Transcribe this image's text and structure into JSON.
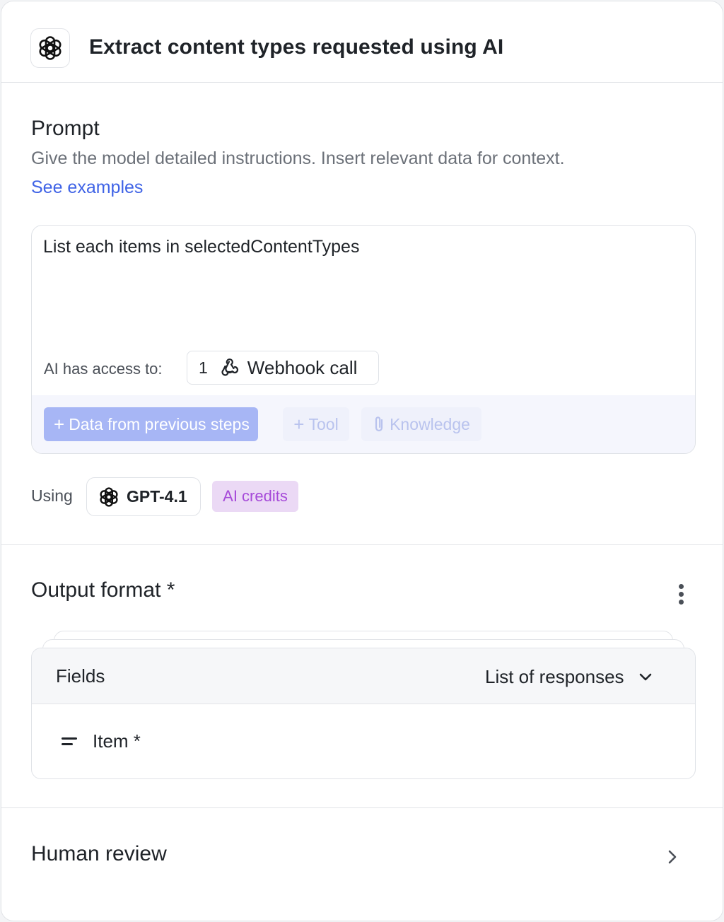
{
  "header": {
    "title": "Extract content types requested using AI",
    "logo_icon": "openai-logo-icon"
  },
  "prompt": {
    "title": "Prompt",
    "description": "Give the model detailed instructions. Insert relevant data for context.",
    "see_examples": "See examples",
    "text": "List each items in selectedContentTypes",
    "access_label": "AI has access to:",
    "access_chip": {
      "step_number": "1",
      "icon": "webhook-icon",
      "name": "Webhook call"
    },
    "toolbar": {
      "data_button": "Data from previous steps",
      "tool_button": "Tool",
      "knowledge_button": "Knowledge"
    }
  },
  "model": {
    "using_label": "Using",
    "name": "GPT-4.1",
    "icon": "openai-logo-icon",
    "credits_badge": "AI credits"
  },
  "output_format": {
    "title": "Output format *",
    "fields_label": "Fields",
    "list_select": "List of responses",
    "fields": [
      {
        "name": "Item *",
        "icon": "text-field-icon"
      }
    ]
  },
  "human_review": {
    "title": "Human review"
  },
  "colors": {
    "link": "#3f63e6",
    "primary_button_disabled": "#a7b6f5",
    "credits_bg": "#ebd9f5",
    "credits_text": "#a64ad9"
  }
}
